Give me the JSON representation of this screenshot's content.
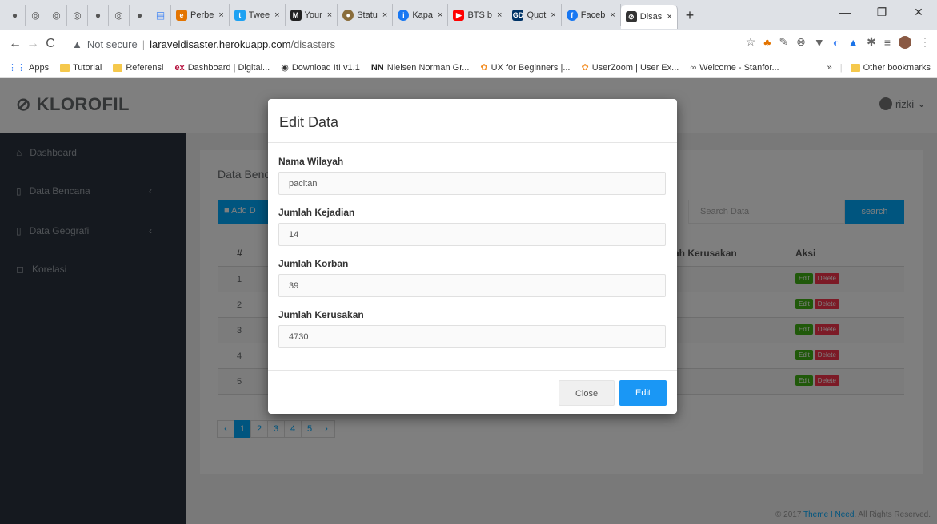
{
  "browser": {
    "tabs": [
      {
        "label": "Perbe",
        "color": "#e37400"
      },
      {
        "label": "Twee",
        "color": "#1da1f2"
      },
      {
        "label": "Your",
        "color": "#222222"
      },
      {
        "label": "Statu",
        "color": "#8a6d3b"
      },
      {
        "label": "Kapa",
        "color": "#1877f2"
      },
      {
        "label": "BTS b",
        "color": "#ff0000"
      },
      {
        "label": "Quot",
        "color": "#003366"
      },
      {
        "label": "Faceb",
        "color": "#1877f2"
      },
      {
        "label": "Disas",
        "color": "#333333"
      }
    ],
    "tab_close": "×",
    "new_tab": "+",
    "url_warning": "Not secure",
    "url_host": "laraveldisaster.herokuapp.com",
    "url_path": "/disasters",
    "bookmarks": [
      "Apps",
      "Tutorial",
      "Referensi",
      "Dashboard | Digital...",
      "Download It! v1.1",
      "Nielsen Norman Gr...",
      "UX for Beginners |...",
      "UserZoom | User Ex...",
      "Welcome - Stanfor..."
    ],
    "bookmarks_more": "»",
    "other_bookmarks": "Other bookmarks"
  },
  "app": {
    "brand": "KLOROFIL",
    "user_name": "rizki",
    "sidebar": [
      {
        "label": "Dashboard",
        "icon": "home-icon"
      },
      {
        "label": "Data Bencana",
        "icon": "file-icon"
      },
      {
        "label": "Data Geografi",
        "icon": "file-icon"
      },
      {
        "label": "Korelasi",
        "icon": "chat-icon"
      }
    ],
    "panel_title": "Data Benc",
    "add_button": "Add D",
    "search_placeholder": "Search Data",
    "search_button": "search",
    "table": {
      "headers": {
        "num": "#",
        "damage": "ah Kerusakan",
        "action": "Aksi"
      },
      "rows": [
        "1",
        "2",
        "3",
        "4",
        "5"
      ],
      "edit_label": "Edit",
      "delete_label": "Delete"
    },
    "pagination": {
      "prev": "‹",
      "pages": [
        "1",
        "2",
        "3",
        "4",
        "5"
      ],
      "next": "›",
      "current": "1"
    },
    "footer_prefix": "© 2017 ",
    "footer_link": "Theme I Need",
    "footer_suffix": ". All Rights Reserved."
  },
  "modal": {
    "title": "Edit Data",
    "fields": [
      {
        "label": "Nama Wilayah",
        "value": "pacitan"
      },
      {
        "label": "Jumlah Kejadian",
        "value": "14"
      },
      {
        "label": "Jumlah Korban",
        "value": "39"
      },
      {
        "label": "Jumlah Kerusakan",
        "value": "4730"
      }
    ],
    "close_button": "Close",
    "submit_button": "Edit"
  },
  "colors": {
    "accent": "#00aaff",
    "sidebar": "#2b333e",
    "edit_green": "#41b314",
    "delete_red": "#f9354c"
  }
}
